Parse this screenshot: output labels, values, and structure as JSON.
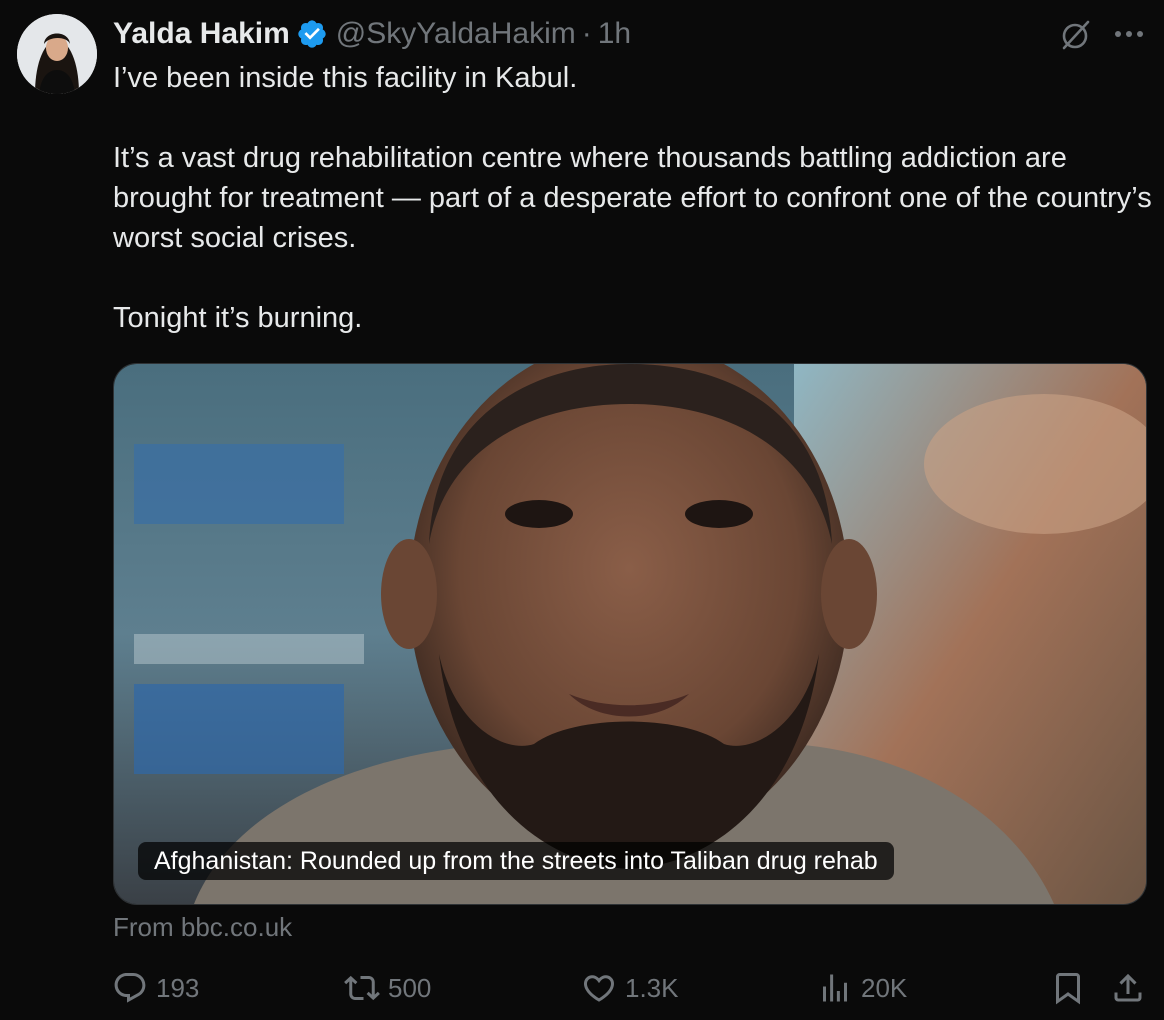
{
  "author": {
    "display_name": "Yalda Hakim",
    "handle": "@SkyYaldaHakim",
    "separator": "·",
    "time": "1h",
    "verified": true
  },
  "tweet": {
    "paragraphs": [
      "I’ve been inside this facility in Kabul.",
      "It’s a vast drug rehabilitation centre where thousands battling addiction are brought for treatment — part of a desperate effort to confront one of the country’s worst social crises.",
      "Tonight it’s burning."
    ]
  },
  "card": {
    "title": "Afghanistan: Rounded up from the streets into Taliban drug rehab",
    "source": "From bbc.co.uk"
  },
  "actions": {
    "replies": "193",
    "reposts": "500",
    "likes": "1.3K",
    "views": "20K"
  },
  "icons": {
    "verified": "verified-badge-icon",
    "grok": "grok-icon",
    "more": "more-icon",
    "reply": "reply-icon",
    "repost": "repost-icon",
    "like": "heart-icon",
    "views": "views-icon",
    "bookmark": "bookmark-icon",
    "share": "share-icon"
  },
  "colors": {
    "background": "#0a0a0a",
    "text": "#e7e9ea",
    "muted": "#71767b",
    "verified": "#1d9bf0"
  }
}
